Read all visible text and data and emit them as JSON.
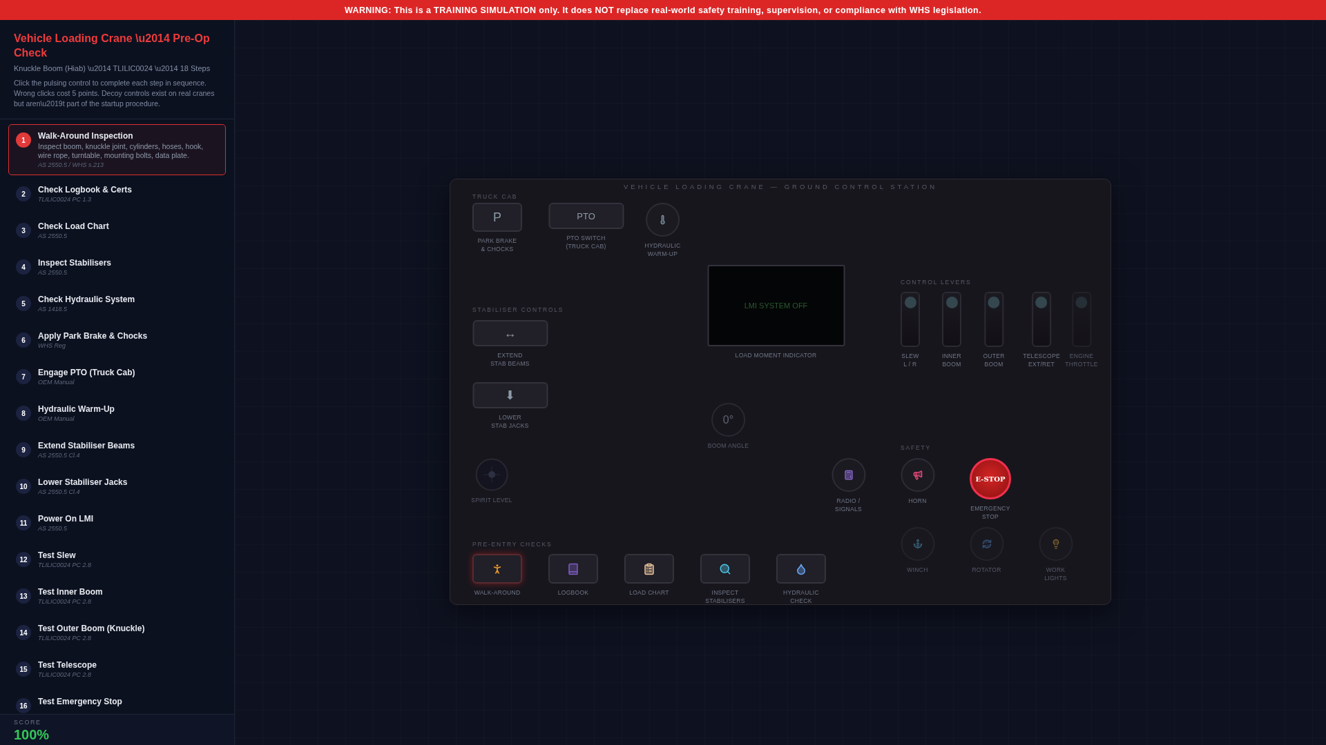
{
  "banner": "WARNING: This is a TRAINING SIMULATION only. It does NOT replace real-world safety training, supervision, or compliance with WHS legislation.",
  "sidebar": {
    "title": "Vehicle Loading Crane \\u2014 Pre-Op Check",
    "subtitle": "Knuckle Boom (Hiab) \\u2014 TLILIC0024 \\u2014 18 Steps",
    "description": "Click the pulsing control to complete each step in sequence. Wrong clicks cost 5 points. Decoy controls exist on real cranes but aren\\u2019t part of the startup procedure.",
    "steps": [
      {
        "number": "1",
        "title": "Walk-Around Inspection",
        "detail": "Inspect boom, knuckle joint, cylinders, hoses, hook, wire rope, turntable, mounting bolts, data plate.",
        "reference": "AS 2550.5 / WHS s.213",
        "selected": true
      },
      {
        "number": "2",
        "title": "Check Logbook & Certs",
        "reference": "TLILIC0024 PC 1.3",
        "selected": false
      },
      {
        "number": "3",
        "title": "Check Load Chart",
        "reference": "AS 2550.5",
        "selected": false
      },
      {
        "number": "4",
        "title": "Inspect Stabilisers",
        "reference": "AS 2550.5",
        "selected": false
      },
      {
        "number": "5",
        "title": "Check Hydraulic System",
        "reference": "AS 1418.5",
        "selected": false
      },
      {
        "number": "6",
        "title": "Apply Park Brake & Chocks",
        "reference": "WHS Reg",
        "selected": false
      },
      {
        "number": "7",
        "title": "Engage PTO (Truck Cab)",
        "reference": "OEM Manual",
        "selected": false
      },
      {
        "number": "8",
        "title": "Hydraulic Warm-Up",
        "reference": "OEM Manual",
        "selected": false
      },
      {
        "number": "9",
        "title": "Extend Stabiliser Beams",
        "reference": "AS 2550.5 Cl.4",
        "selected": false
      },
      {
        "number": "10",
        "title": "Lower Stabiliser Jacks",
        "reference": "AS 2550.5 Cl.4",
        "selected": false
      },
      {
        "number": "11",
        "title": "Power On LMI",
        "reference": "AS 2550.5",
        "selected": false
      },
      {
        "number": "12",
        "title": "Test Slew",
        "reference": "TLILIC0024 PC 2.8",
        "selected": false
      },
      {
        "number": "13",
        "title": "Test Inner Boom",
        "reference": "TLILIC0024 PC 2.8",
        "selected": false
      },
      {
        "number": "14",
        "title": "Test Outer Boom (Knuckle)",
        "reference": "TLILIC0024 PC 2.8",
        "selected": false
      },
      {
        "number": "15",
        "title": "Test Telescope",
        "reference": "TLILIC0024 PC 2.8",
        "selected": false
      },
      {
        "number": "16",
        "title": "Test Emergency Stop",
        "selected": false
      }
    ],
    "score": {
      "label": "SCORE",
      "value": "100%"
    }
  },
  "panel": {
    "title": "VEHICLE LOADING CRANE — GROUND CONTROL STATION",
    "section_labels": [
      "TRUCK CAB",
      "STABILISER CONTROLS",
      "CONTROL LEVERS",
      "SAFETY",
      "PRE-ENTRY CHECKS"
    ],
    "controls": [
      {
        "kind": "key",
        "symbol": "P",
        "label": "PARK BRAKE\n& CHOCKS",
        "highlighted": false
      },
      {
        "kind": "key",
        "symbol": "PTO",
        "label": "PTO SWITCH\n(TRUCK CAB)",
        "highlighted": false
      },
      {
        "kind": "round",
        "label": "HYDRAULIC\nWARM-UP",
        "dim": false
      },
      {
        "kind": "key",
        "symbol": "↔",
        "label": "EXTEND\nSTAB BEAMS",
        "highlighted": false
      },
      {
        "kind": "key",
        "symbol": "⬇",
        "label": "LOWER\nSTAB JACKS",
        "highlighted": false
      },
      {
        "kind": "display",
        "text": "LMI SYSTEM OFF",
        "label": "LOAD MOMENT INDICATOR"
      },
      {
        "kind": "gauge",
        "text": "0°",
        "label": "BOOM ANGLE"
      },
      {
        "kind": "level",
        "label": "SPIRIT LEVEL"
      },
      {
        "kind": "lever",
        "label": "SLEW\nL / R",
        "dim": false
      },
      {
        "kind": "lever",
        "label": "INNER\nBOOM",
        "dim": false
      },
      {
        "kind": "lever",
        "label": "OUTER\nBOOM",
        "dim": false
      },
      {
        "kind": "lever",
        "label": "TELESCOPE\nEXT/RET",
        "dim": false
      },
      {
        "kind": "lever",
        "label": "ENGINE\nTHROTTLE",
        "dim": true
      },
      {
        "kind": "round",
        "label": "RADIO /\nSIGNALS",
        "dim": false
      },
      {
        "kind": "round",
        "label": "HORN",
        "dim": false
      },
      {
        "kind": "estop",
        "text": "E-STOP",
        "label": "EMERGENCY\nSTOP"
      },
      {
        "kind": "round",
        "label": "WINCH",
        "dim": true
      },
      {
        "kind": "round",
        "label": "ROTATOR",
        "dim": true
      },
      {
        "kind": "round",
        "label": "WORK\nLIGHTS",
        "dim": true
      },
      {
        "kind": "icon-key",
        "label": "WALK-AROUND",
        "highlighted": true
      },
      {
        "kind": "icon-key",
        "label": "LOGBOOK",
        "highlighted": false
      },
      {
        "kind": "icon-key",
        "label": "LOAD CHART",
        "highlighted": false
      },
      {
        "kind": "icon-key",
        "label": "INSPECT\nSTABILISERS",
        "highlighted": false
      },
      {
        "kind": "icon-key",
        "label": "HYDRAULIC\nCHECK",
        "highlighted": false
      }
    ]
  }
}
